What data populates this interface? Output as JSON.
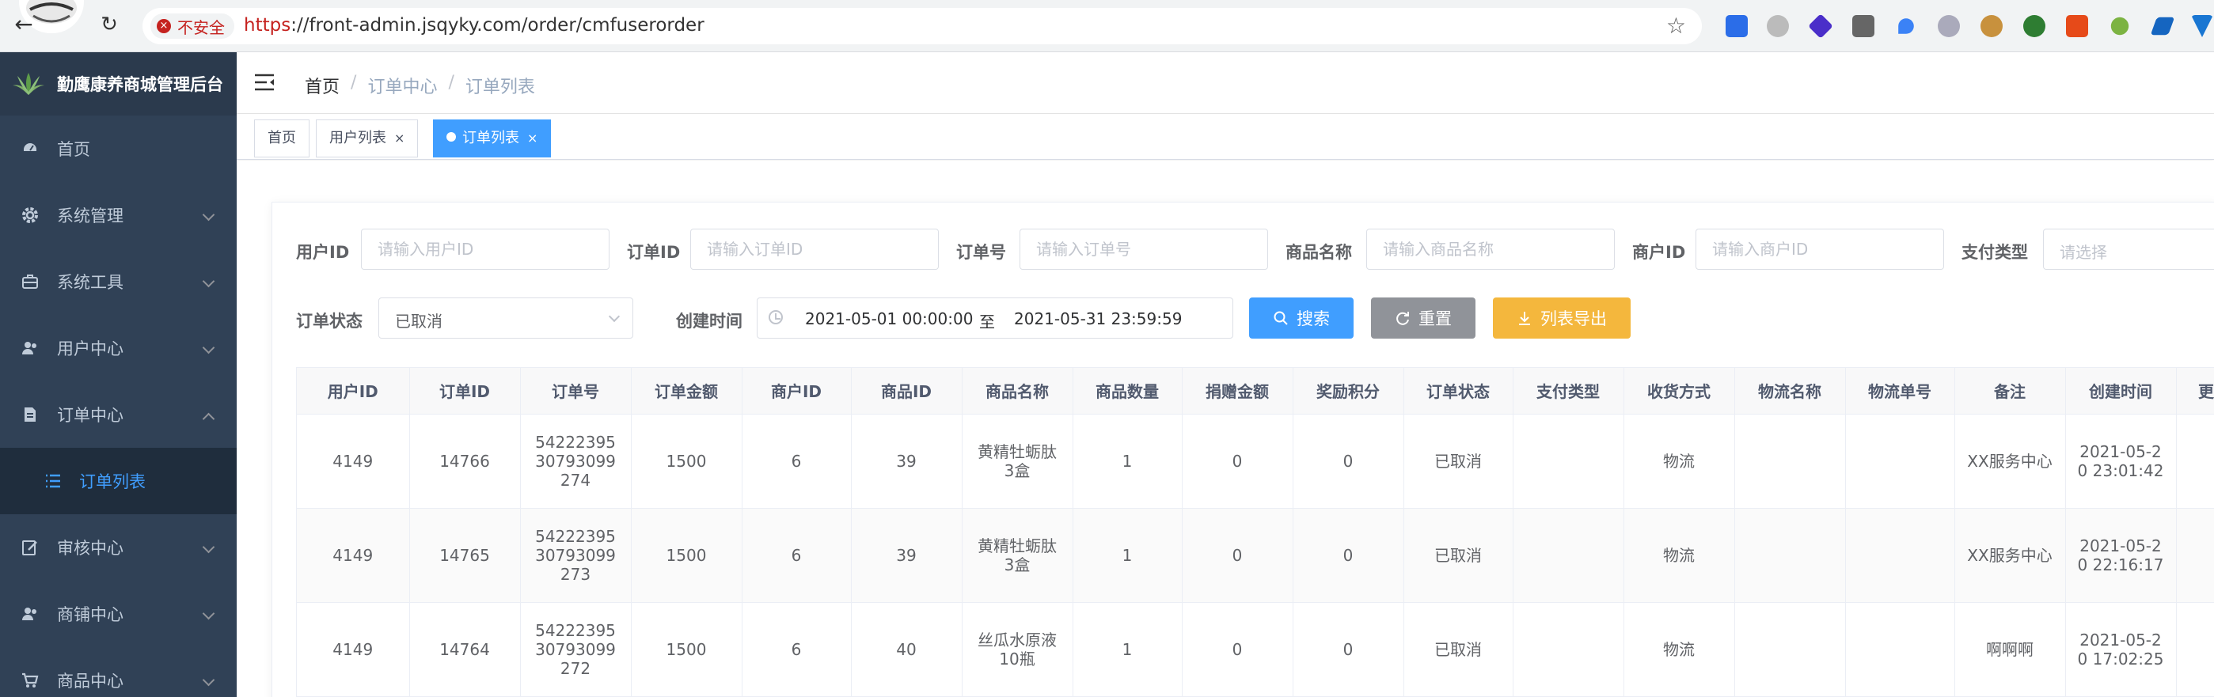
{
  "browser": {
    "insecure_label": "不安全",
    "url_scheme": "https",
    "url_rest": "://front-admin.jsqyky.com/order/cmfuserorder"
  },
  "sidebar": {
    "brand": "勤鹰康养商城管理后台",
    "items": [
      {
        "label": "首页",
        "icon": "dashboard-icon"
      },
      {
        "label": "系统管理",
        "icon": "gear-icon"
      },
      {
        "label": "系统工具",
        "icon": "toolbox-icon"
      },
      {
        "label": "用户中心",
        "icon": "users-icon"
      },
      {
        "label": "订单中心",
        "icon": "order-icon"
      },
      {
        "label": "审核中心",
        "icon": "edit-icon"
      },
      {
        "label": "商铺中心",
        "icon": "users-icon"
      },
      {
        "label": "商品中心",
        "icon": "cart-icon"
      }
    ],
    "sub_item": "订单列表"
  },
  "header": {
    "breadcrumb": [
      "首页",
      "订单中心",
      "订单列表"
    ],
    "separator": "/"
  },
  "tags": [
    {
      "label": "首页"
    },
    {
      "label": "用户列表",
      "close": "×"
    },
    {
      "label": "订单列表",
      "close": "×"
    }
  ],
  "form": {
    "user_id": {
      "label": "用户ID",
      "placeholder": "请输入用户ID"
    },
    "order_id": {
      "label": "订单ID",
      "placeholder": "请输入订单ID"
    },
    "order_no": {
      "label": "订单号",
      "placeholder": "请输入订单号"
    },
    "goods_name": {
      "label": "商品名称",
      "placeholder": "请输入商品名称"
    },
    "merchant_id": {
      "label": "商户ID",
      "placeholder": "请输入商户ID"
    },
    "pay_type": {
      "label": "支付类型",
      "placeholder": "请选择"
    },
    "order_status": {
      "label": "订单状态",
      "value": "已取消"
    },
    "create_time": {
      "label": "创建时间",
      "start": "2021-05-01 00:00:00",
      "sep": "至",
      "end": "2021-05-31 23:59:59"
    },
    "search_btn": "搜索",
    "reset_btn": "重置",
    "export_btn": "列表导出"
  },
  "table": {
    "headers": [
      "用户ID",
      "订单ID",
      "订单号",
      "订单金额",
      "商户ID",
      "商品ID",
      "商品名称",
      "商品数量",
      "捐赠金额",
      "奖励积分",
      "订单状态",
      "支付类型",
      "收货方式",
      "物流名称",
      "物流单号",
      "备注",
      "创建时间",
      "更"
    ],
    "rows": [
      [
        "4149",
        "14766",
        "5422239530793099274",
        "1500",
        "6",
        "39",
        "黄精牡蛎肽3盒",
        "1",
        "0",
        "0",
        "已取消",
        "",
        "物流",
        "",
        "",
        "XX服务中心",
        "2021-05-20 23:01:42",
        ""
      ],
      [
        "4149",
        "14765",
        "5422239530793099273",
        "1500",
        "6",
        "39",
        "黄精牡蛎肽3盒",
        "1",
        "0",
        "0",
        "已取消",
        "",
        "物流",
        "",
        "",
        "XX服务中心",
        "2021-05-20 22:16:17",
        ""
      ],
      [
        "4149",
        "14764",
        "5422239530793099272",
        "1500",
        "6",
        "40",
        "丝瓜水原液10瓶",
        "1",
        "0",
        "0",
        "已取消",
        "",
        "物流",
        "",
        "",
        "啊啊啊",
        "2021-05-20 17:02:25",
        ""
      ]
    ]
  }
}
